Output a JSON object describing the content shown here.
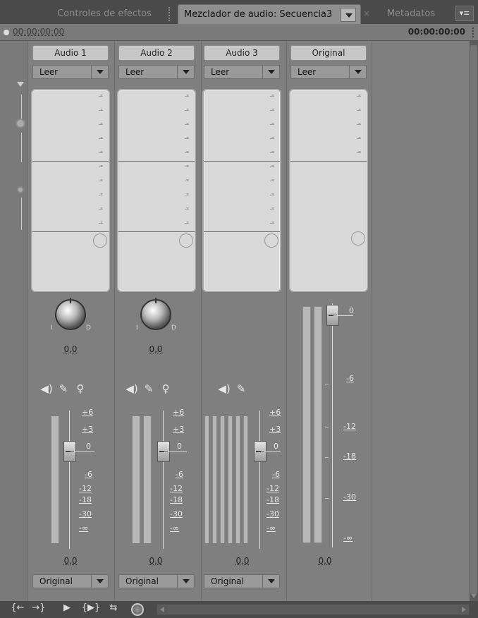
{
  "tabs": [
    {
      "label": "Controles de efectos",
      "active": false
    },
    {
      "label": "Mezclador de audio: Secuencia3",
      "active": true
    },
    {
      "label": "Metadatos",
      "active": false
    }
  ],
  "panel_menu_icon": "panel-menu-icon",
  "timecode": {
    "left": "00:00:00:00",
    "right": "00:00:00:00"
  },
  "strips": [
    {
      "name": "Audio 1",
      "mode": "Leer",
      "pan_value": "0,0",
      "pan_left": "I",
      "pan_right": "D",
      "volume": "0,0",
      "output": "Original",
      "icons": [
        "speaker-icon",
        "pencil-icon",
        "mic-icon"
      ]
    },
    {
      "name": "Audio 2",
      "mode": "Leer",
      "pan_value": "0,0",
      "pan_left": "I",
      "pan_right": "D",
      "volume": "0,0",
      "output": "Original",
      "icons": [
        "speaker-icon",
        "pencil-icon",
        "mic-icon"
      ]
    },
    {
      "name": "Audio 3",
      "mode": "Leer",
      "volume": "0,0",
      "output": "Original",
      "icons": [
        "speaker-icon",
        "pencil-icon"
      ]
    },
    {
      "name": "Original",
      "mode": "Leer",
      "volume": "0,0"
    }
  ],
  "fader_scale": [
    "+6",
    "+3",
    "0",
    "-6",
    "-12",
    "-18",
    "-30",
    "-∞"
  ],
  "master_scale": [
    "0",
    "-6",
    "-12",
    "-18",
    "-30",
    "-∞"
  ],
  "fader_level_db": 0,
  "bottom_controls": [
    "go-to-in-icon",
    "go-to-out-icon",
    "play-icon",
    "play-in-to-out-icon",
    "loop-icon",
    "record-icon"
  ],
  "icon_glyphs": {
    "speaker": "◀)",
    "pencil": "✎",
    "mic": "♀",
    "go_in": "{←",
    "go_out": "→}",
    "play": "▶",
    "play_in_out": "{▶}",
    "loop": "⇆",
    "menu": "▾≡"
  }
}
